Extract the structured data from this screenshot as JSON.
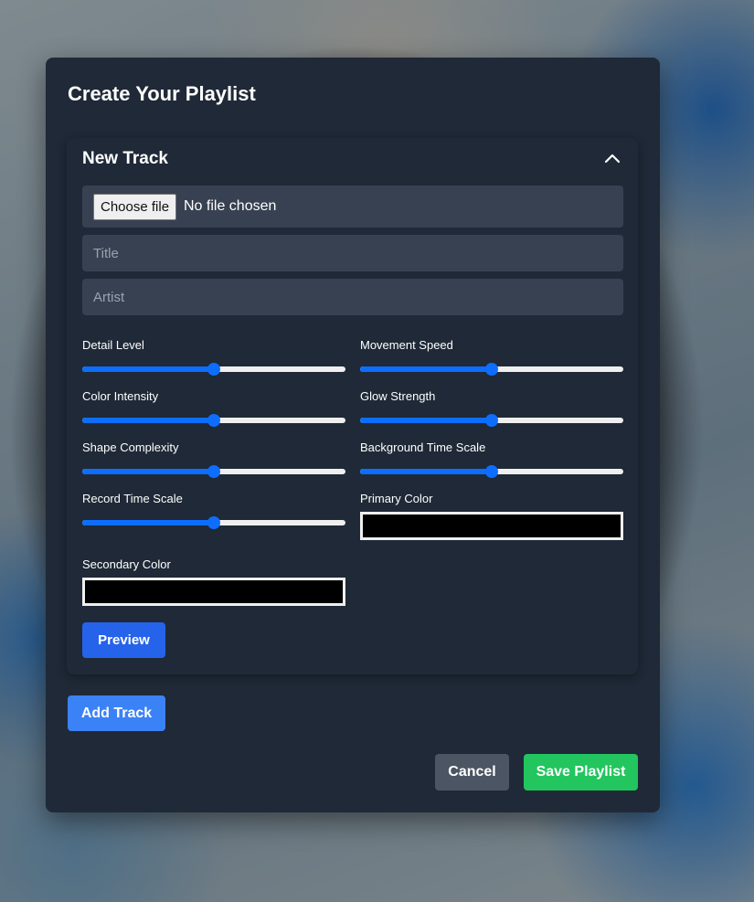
{
  "modal": {
    "title": "Create Your Playlist"
  },
  "track": {
    "title": "New Track",
    "collapse_icon": "chevron-up-icon",
    "file": {
      "button_label": "Choose file",
      "status": "No file chosen"
    },
    "title_field": {
      "placeholder": "Title",
      "value": ""
    },
    "artist_field": {
      "placeholder": "Artist",
      "value": ""
    },
    "sliders": [
      {
        "label": "Detail Level",
        "value_fraction": 0.5
      },
      {
        "label": "Movement Speed",
        "value_fraction": 0.5
      },
      {
        "label": "Color Intensity",
        "value_fraction": 0.5
      },
      {
        "label": "Glow Strength",
        "value_fraction": 0.5
      },
      {
        "label": "Shape Complexity",
        "value_fraction": 0.5
      },
      {
        "label": "Background Time Scale",
        "value_fraction": 0.5
      },
      {
        "label": "Record Time Scale",
        "value_fraction": 0.5
      }
    ],
    "colors": {
      "primary": {
        "label": "Primary Color",
        "value": "#000000"
      },
      "secondary": {
        "label": "Secondary Color",
        "value": "#000000"
      }
    },
    "preview_label": "Preview"
  },
  "actions": {
    "add_track_label": "Add Track",
    "cancel_label": "Cancel",
    "save_label": "Save Playlist"
  },
  "theme": {
    "panel": "#1f2937",
    "input": "#374151",
    "slider_accent": "#0d6efd",
    "preview": "#2563eb",
    "add_track": "#3b82f6",
    "cancel": "#4b5563",
    "save": "#22c55e"
  }
}
